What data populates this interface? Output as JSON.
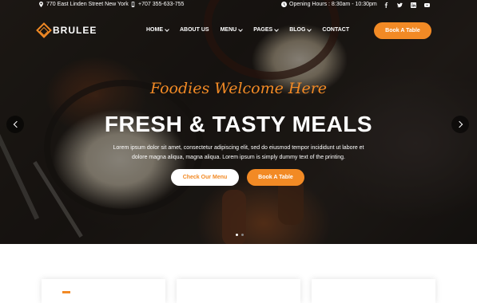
{
  "topbar": {
    "address": "770 East Linden Street New York",
    "phone": "+707 355-633-755",
    "hours": "Opening Hours : 8:30am - 10:30pm",
    "social": [
      "facebook-icon",
      "twitter-icon",
      "linkedin-icon",
      "youtube-icon"
    ]
  },
  "brand": {
    "name": "BRULEE"
  },
  "nav": {
    "items": [
      {
        "label": "HOME",
        "has_dropdown": true
      },
      {
        "label": "ABOUT US",
        "has_dropdown": false
      },
      {
        "label": "MENU",
        "has_dropdown": true
      },
      {
        "label": "PAGES",
        "has_dropdown": true
      },
      {
        "label": "BLOG",
        "has_dropdown": true
      },
      {
        "label": "CONTACT",
        "has_dropdown": false
      }
    ],
    "cta": "Book A Table"
  },
  "hero": {
    "script_title": "Foodies Welcome Here",
    "headline": "FRESH & TASTY MEALS",
    "description_line1": "Lorem ipsum dolor sit amet, consectetur adipiscing elit, sed do eiusmod tempor incididunt ut labore et",
    "description_line2": "dolore magna aliqua, magna aliqua. Lorem ipsum is simply dummy text of the printing.",
    "primary_button": "Check Our Menu",
    "secondary_button": "Book A Table",
    "slide_count": 2,
    "active_slide": 1
  },
  "colors": {
    "accent": "#f28a25",
    "dark": "#1e1a17",
    "white": "#ffffff"
  }
}
